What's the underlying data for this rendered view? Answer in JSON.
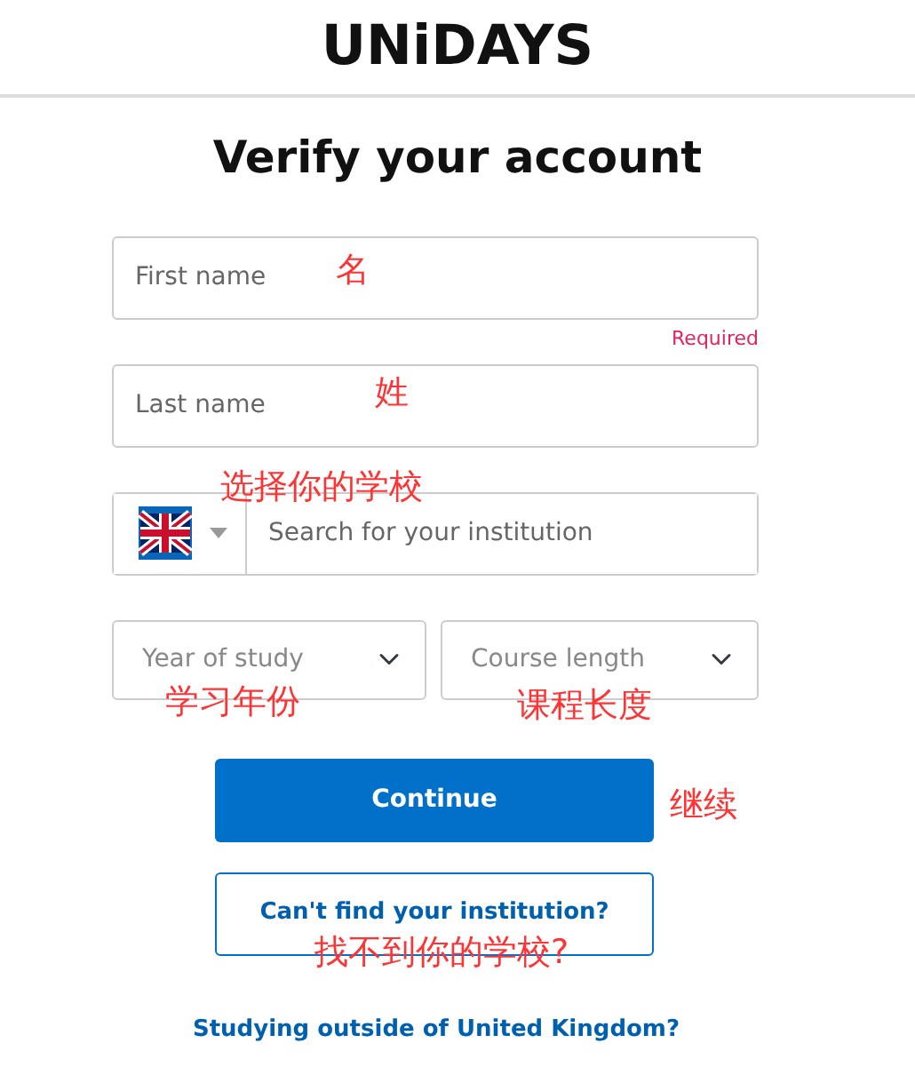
{
  "header": {
    "logo": "UNiDAYS"
  },
  "title": "Verify your account",
  "fields": [
    {
      "kind": "text",
      "placeholder": "First name",
      "error": "Required"
    },
    {
      "kind": "text",
      "placeholder": "Last name"
    },
    {
      "kind": "institution",
      "placeholder": "Search for your institution"
    }
  ],
  "selects": [
    {
      "placeholder": "Year of study"
    },
    {
      "placeholder": "Course length"
    }
  ],
  "buttons": [
    {
      "kind": "primary",
      "label": "Continue"
    },
    {
      "kind": "outline",
      "label": "Can't find your institution?"
    }
  ],
  "link": "Studying outside of United Kingdom?",
  "annotations": [
    "名",
    "姓",
    "选择你的学校",
    "学习年份",
    "课程长度",
    "继续",
    "找不到你的学校?"
  ]
}
